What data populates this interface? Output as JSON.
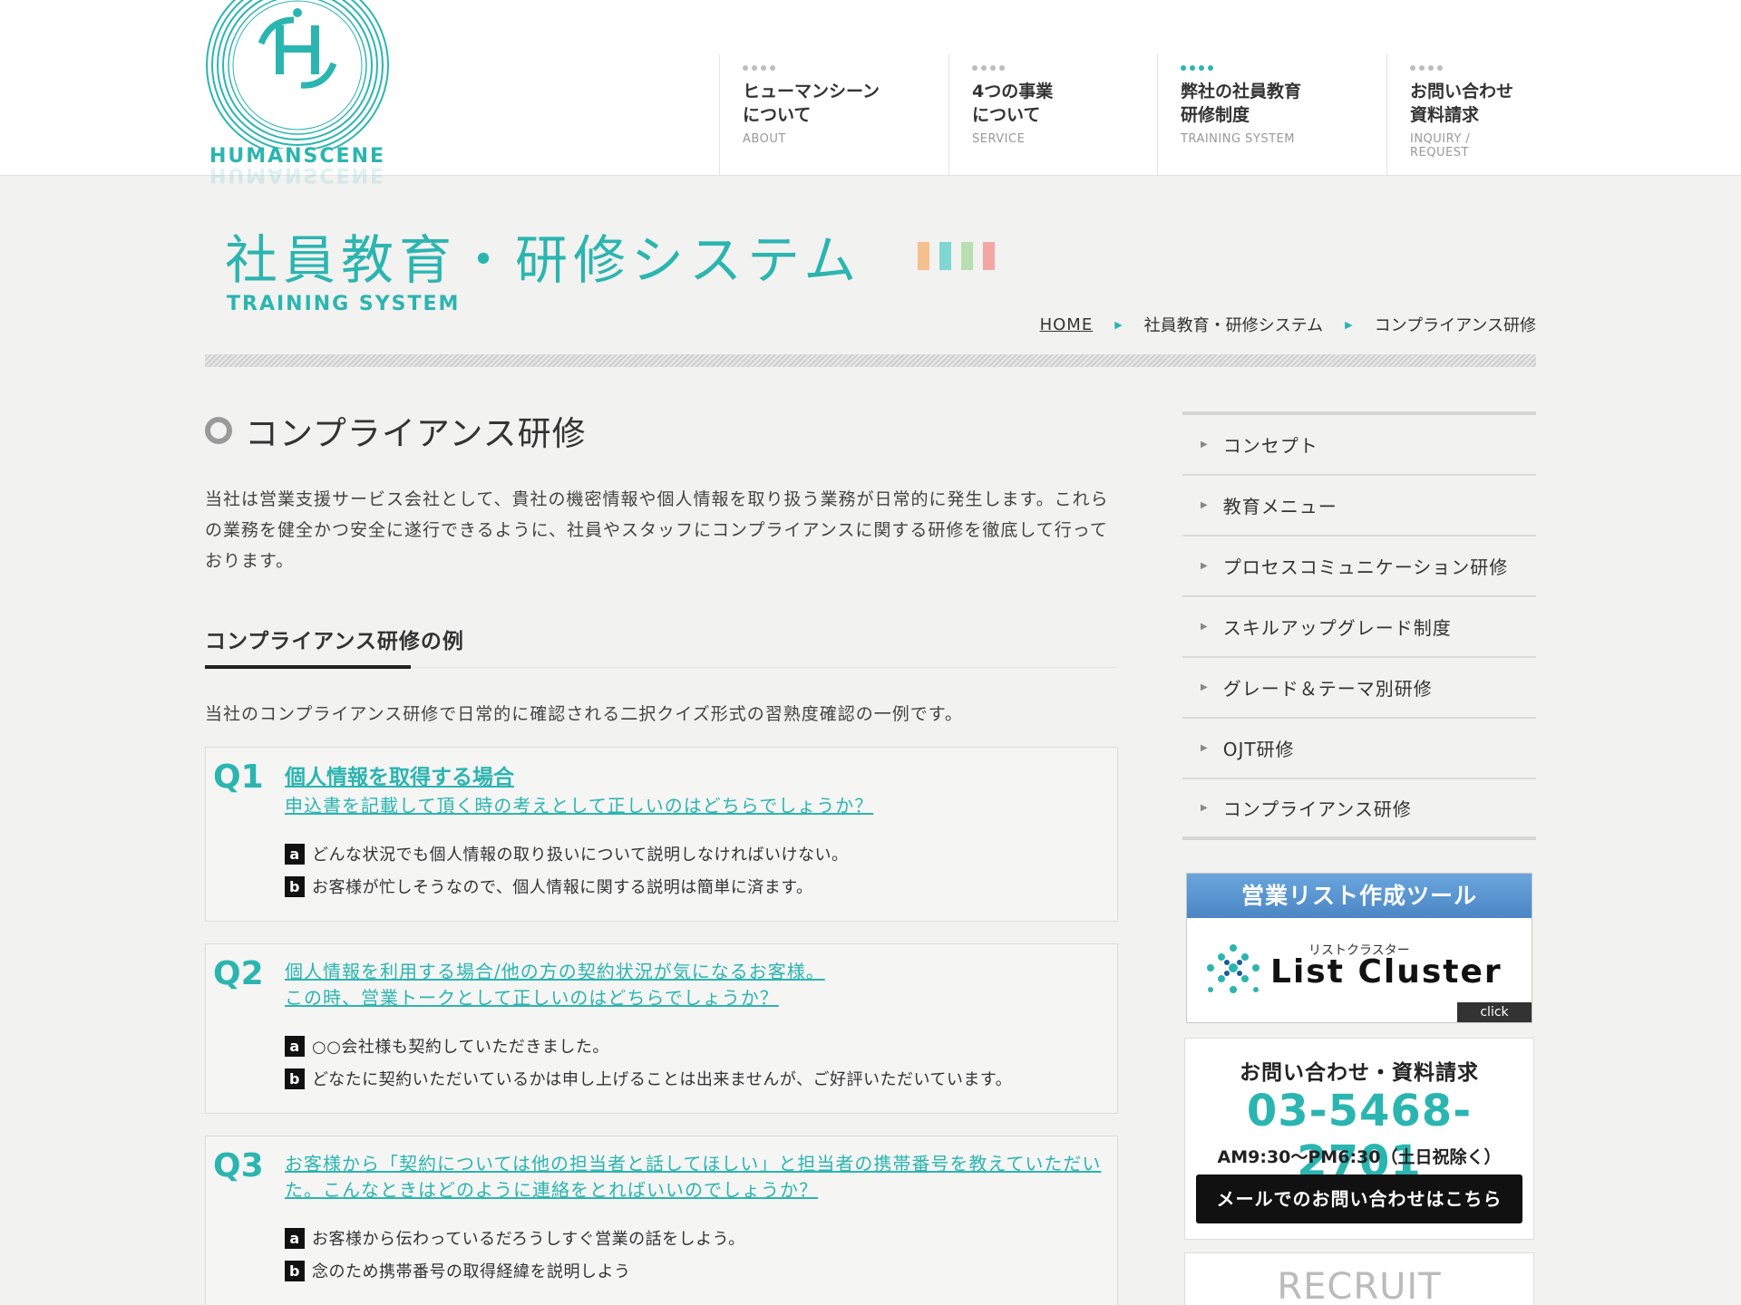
{
  "header": {
    "logo_text": "HUMANSCENE",
    "nav": [
      {
        "jp": "ヒューマンシーン\nについて",
        "en": "ABOUT",
        "active": false
      },
      {
        "jp": "4つの事業\nについて",
        "en": "SERVICE",
        "active": false
      },
      {
        "jp": "弊社の社員教育\n研修制度",
        "en": "TRAINING SYSTEM",
        "active": true
      },
      {
        "jp": "お問い合わせ\n資料請求",
        "en": "INQUIRY / REQUEST",
        "active": false
      }
    ]
  },
  "page_title": {
    "jp": "社員教育・研修システム",
    "en": "TRAINING SYSTEM",
    "bar_colors": [
      "#f5c08e",
      "#7fd6d4",
      "#b7dfb0",
      "#f2a7a3"
    ]
  },
  "breadcrumb": {
    "home": "HOME",
    "level1": "社員教育・研修システム",
    "current": "コンプライアンス研修"
  },
  "main": {
    "heading": "コンプライアンス研修",
    "intro": "当社は営業支援サービス会社として、貴社の機密情報や個人情報を取り扱う業務が日常的に発生します。これらの業務を健全かつ安全に遂行できるように、社員やスタッフにコンプライアンスに関する研修を徹底して行っております。",
    "subheading": "コンプライアンス研修の例",
    "lead": "当社のコンプライアンス研修で日常的に確認される二択クイズ形式の習熟度確認の一例です。",
    "questions": [
      {
        "num": "Q1",
        "title": "個人情報を取得する場合",
        "text": "申込書を記載して頂く時の考えとして正しいのはどちらでしょうか？",
        "answers": [
          {
            "mark": "a",
            "text": "どんな状況でも個人情報の取り扱いについて説明しなければいけない。"
          },
          {
            "mark": "b",
            "text": "お客様が忙しそうなので、個人情報に関する説明は簡単に済ます。"
          }
        ]
      },
      {
        "num": "Q2",
        "title": "",
        "text": "個人情報を利用する場合/他の方の契約状況が気になるお客様。\nこの時、営業トークとして正しいのはどちらでしょうか？",
        "answers": [
          {
            "mark": "a",
            "text": "○○会社様も契約していただきました。"
          },
          {
            "mark": "b",
            "text": "どなたに契約いただいているかは申し上げることは出来ませんが、ご好評いただいています。"
          }
        ]
      },
      {
        "num": "Q3",
        "title": "",
        "text": "お客様から「契約については他の担当者と話してほしい」と担当者の携帯番号を教えていただいた。こんなときはどのように連絡をとればいいのでしょうか？",
        "answers": [
          {
            "mark": "a",
            "text": "お客様から伝わっているだろうしすぐ営業の話をしよう。"
          },
          {
            "mark": "b",
            "text": "念のため携帯番号の取得経緯を説明しよう"
          }
        ]
      }
    ]
  },
  "sidebar": {
    "menu": [
      "コンセプト",
      "教育メニュー",
      "プロセスコミュニケーション研修",
      "スキルアップグレード制度",
      "グレード＆テーマ別研修",
      "OJT研修",
      "コンプライアンス研修"
    ],
    "banner": {
      "top": "営業リスト作成ツール",
      "kana": "リストクラスター",
      "brand": "List Cluster",
      "click": "click"
    },
    "contact": {
      "title": "お問い合わせ・資料請求",
      "phone": "03-5468-2701",
      "hours": "AM9:30〜PM6:30（土日祝除く）",
      "button": "メールでのお問い合わせはこちら"
    },
    "recruit": "RECRUIT"
  },
  "colors": {
    "accent": "#2bb5b0",
    "background": "#f2f2f0"
  }
}
